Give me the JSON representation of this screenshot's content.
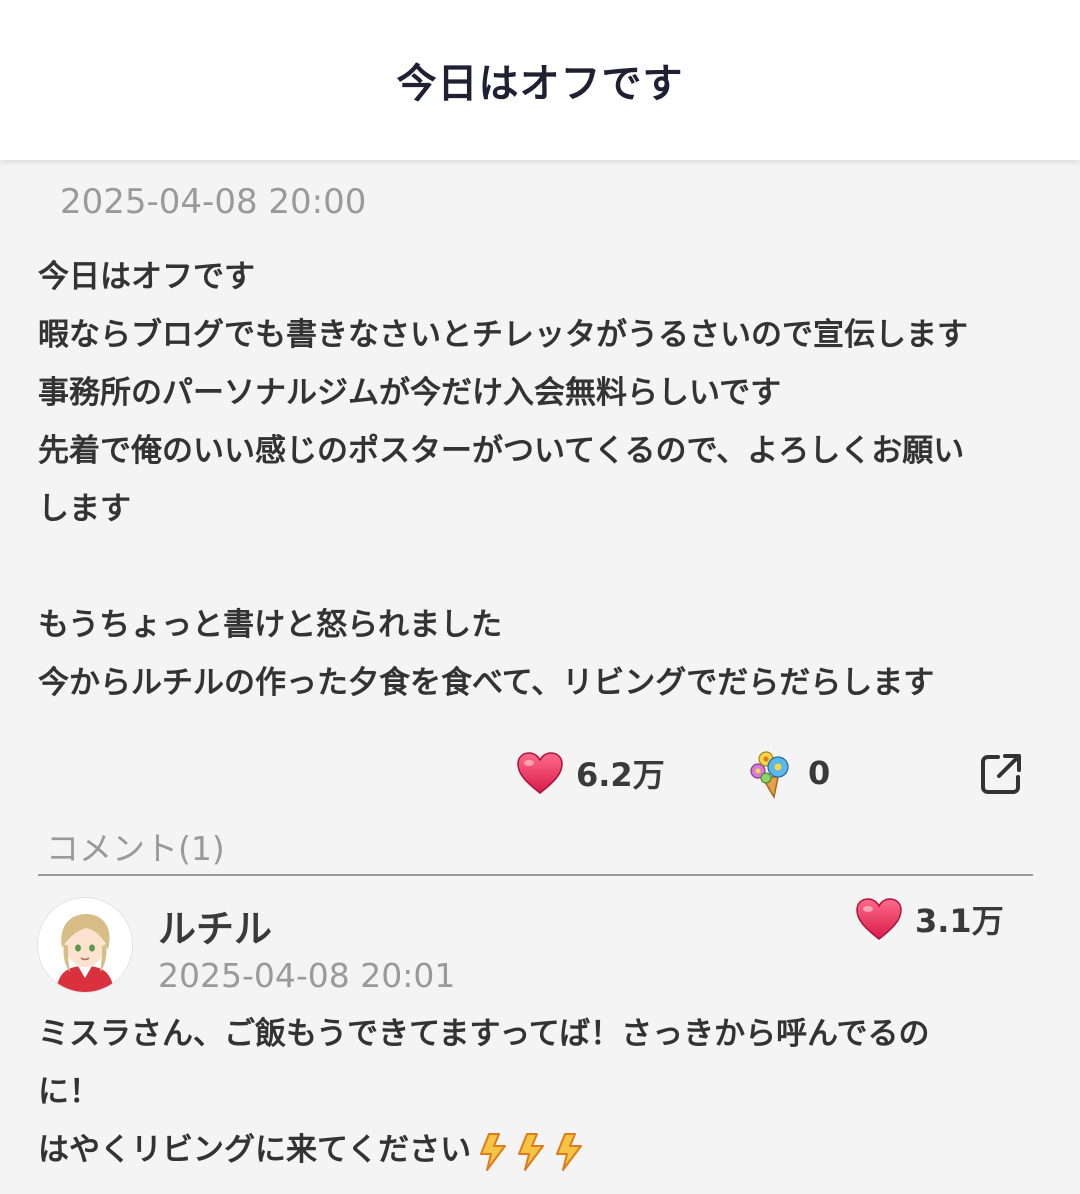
{
  "header": {
    "title": "今日はオフです"
  },
  "post": {
    "date": "2025-04-08 20:00",
    "lines": [
      "今日はオフです",
      "暇ならブログでも書きなさいとチレッタがうるさいので宣伝します",
      "事務所のパーソナルジムが今だけ入会無料らしいです",
      "先着で俺のいい感じのポスターがついてくるので、よろしくお願い",
      "します",
      "",
      "もうちょっと書けと怒られました",
      "今からルチルの作った夕食を食べて、リビングでだらだらします"
    ],
    "likes": "6.2万",
    "gifts": "0"
  },
  "comments": {
    "label": "コメント(1)",
    "items": [
      {
        "name": "ルチル",
        "date": "2025-04-08 20:01",
        "likes": "3.1万",
        "lines": [
          "ミスラさん、ご飯もうできてますってば！さっきから呼んでるの",
          "に！",
          "はやくリビングに来てください"
        ]
      }
    ]
  },
  "icons": {
    "like": "heart-icon",
    "gift": "bouquet-icon",
    "share": "share-external-icon",
    "emoji": "lightning-bolt-icon"
  },
  "colors": {
    "heart": "#e8335a",
    "title": "#1f2133",
    "muted": "#9a9a9a"
  }
}
